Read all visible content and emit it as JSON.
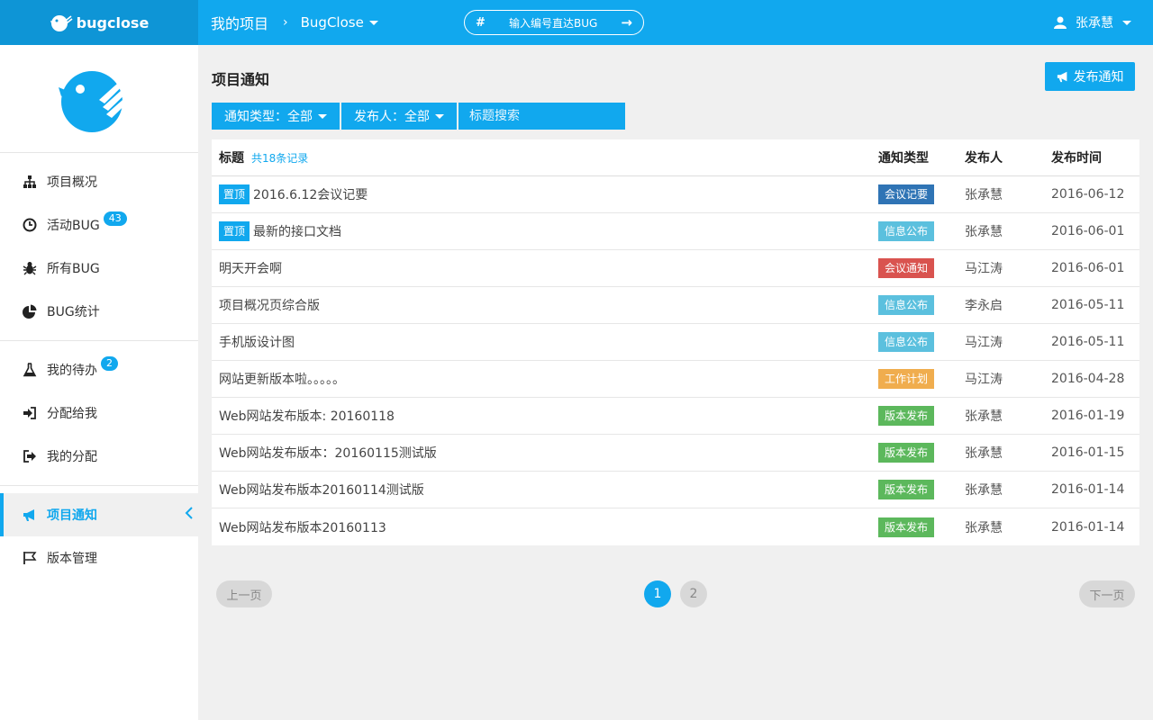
{
  "brand": {
    "name": "bugclose"
  },
  "header": {
    "breadcrumb_root": "我的项目",
    "breadcrumb_sep": "›",
    "project": "BugClose",
    "bug_search": {
      "hash": "#",
      "placeholder": "输入编号直达BUG"
    },
    "user": "张承慧"
  },
  "sidebar": {
    "group1": [
      {
        "label": "项目概况",
        "icon": "sitemap-icon"
      },
      {
        "label": "活动BUG",
        "icon": "clock-icon",
        "badge": "43"
      },
      {
        "label": "所有BUG",
        "icon": "bug-icon"
      },
      {
        "label": "BUG统计",
        "icon": "pie-chart-icon"
      }
    ],
    "group2": [
      {
        "label": "我的待办",
        "icon": "flask-icon",
        "badge": "2"
      },
      {
        "label": "分配给我",
        "icon": "sign-in-icon"
      },
      {
        "label": "我的分配",
        "icon": "sign-out-icon"
      }
    ],
    "group3": [
      {
        "label": "项目通知",
        "icon": "bullhorn-icon",
        "active": true
      },
      {
        "label": "版本管理",
        "icon": "flag-icon"
      }
    ]
  },
  "main": {
    "title": "项目通知",
    "publish_button": "发布通知",
    "filters": {
      "type": "通知类型：全部",
      "publisher": "发布人：全部",
      "search_placeholder": "标题搜索"
    },
    "table": {
      "headers": {
        "title": "标题",
        "count": "共18条记录",
        "type": "通知类型",
        "publisher": "发布人",
        "time": "发布时间"
      },
      "rows": [
        {
          "pin": "置顶",
          "title": "2016.6.12会议记要",
          "type": "会议记要",
          "type_color": "#2f74b5",
          "publisher": "张承慧",
          "time": "2016-06-12"
        },
        {
          "pin": "置顶",
          "title": "最新的接口文档",
          "type": "信息公布",
          "type_color": "#5bc0de",
          "publisher": "张承慧",
          "time": "2016-06-01"
        },
        {
          "pin": "",
          "title": "明天开会啊",
          "type": "会议通知",
          "type_color": "#d9534f",
          "publisher": "马江涛",
          "time": "2016-06-01"
        },
        {
          "pin": "",
          "title": "项目概况页综合版",
          "type": "信息公布",
          "type_color": "#5bc0de",
          "publisher": "李永启",
          "time": "2016-05-11"
        },
        {
          "pin": "",
          "title": "手机版设计图",
          "type": "信息公布",
          "type_color": "#5bc0de",
          "publisher": "马江涛",
          "time": "2016-05-11"
        },
        {
          "pin": "",
          "title": "网站更新版本啦。。。。。",
          "type": "工作计划",
          "type_color": "#f0ad4e",
          "publisher": "马江涛",
          "time": "2016-04-28"
        },
        {
          "pin": "",
          "title": "Web网站发布版本: 20160118",
          "type": "版本发布",
          "type_color": "#5cb85c",
          "publisher": "张承慧",
          "time": "2016-01-19"
        },
        {
          "pin": "",
          "title": "Web网站发布版本：20160115测试版",
          "type": "版本发布",
          "type_color": "#5cb85c",
          "publisher": "张承慧",
          "time": "2016-01-15"
        },
        {
          "pin": "",
          "title": "Web网站发布版本20160114测试版",
          "type": "版本发布",
          "type_color": "#5cb85c",
          "publisher": "张承慧",
          "time": "2016-01-14"
        },
        {
          "pin": "",
          "title": "Web网站发布版本20160113",
          "type": "版本发布",
          "type_color": "#5cb85c",
          "publisher": "张承慧",
          "time": "2016-01-14"
        }
      ]
    },
    "pager": {
      "prev": "上一页",
      "next": "下一页",
      "pages": [
        "1",
        "2"
      ],
      "current": "1"
    }
  },
  "colors": {
    "accent": "#11a8ee",
    "accent_dark": "#0e95d6"
  }
}
